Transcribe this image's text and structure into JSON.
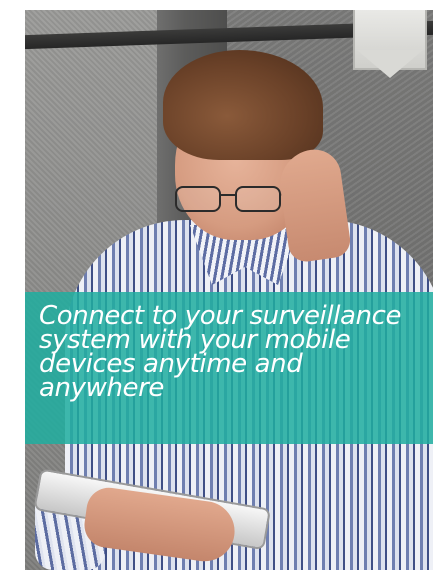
{
  "hero": {
    "headline": "Connect to your surveillance system with your mobile devices anytime and anywhere",
    "overlay_color": "#20ADA0"
  }
}
